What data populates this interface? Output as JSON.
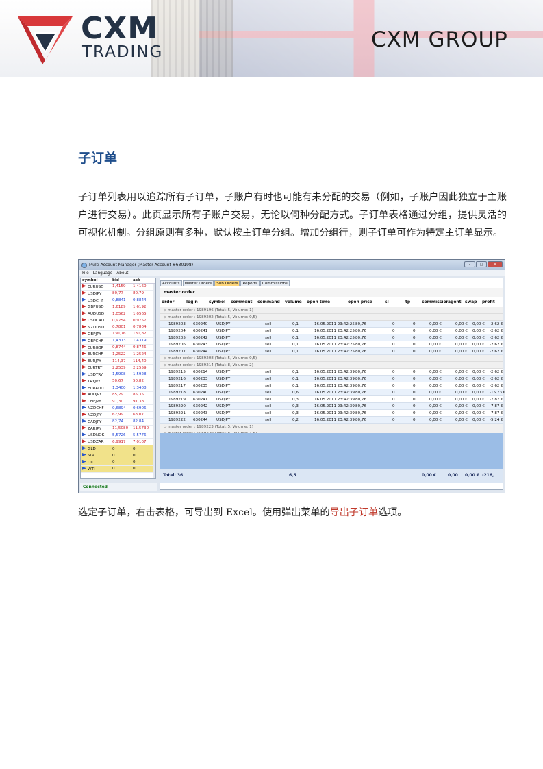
{
  "header": {
    "brand": "CXM",
    "brand_sub": "TRADING",
    "group": "CXM GROUP"
  },
  "section_title": "子订单",
  "paragraph1": "子订单列表用以追踪所有子订单，子账户有时也可能有未分配的交易（例如，子账户因此独立于主账户进行交易）。此页显示所有子账户交易，无论以何种分配方式。子订单表格通过分组，提供灵活的可视化机制。分组原则有多种，默认按主订单分组。增加分组行，则子订单可作为特定主订单显示。",
  "paragraph2": {
    "before": "选定子订单，右击表格，可导出到 Excel。使用弹出菜单的",
    "highlight": "导出子订单",
    "after": "选项。"
  },
  "window": {
    "title": "Multi Account Manager (Master Account #630198)",
    "menu": [
      "File",
      "Language",
      "About"
    ],
    "status": "Connected",
    "quotes_header": [
      "symbol",
      "bid",
      "ask"
    ],
    "quotes": [
      [
        "EURUSD",
        "1,4159",
        "1,4160",
        "dn"
      ],
      [
        "USDJPY",
        "80,77",
        "80,79",
        "dn"
      ],
      [
        "USDCHF",
        "0,8841",
        "0,8844",
        "up"
      ],
      [
        "GBPUSD",
        "1,6189",
        "1,6192",
        "dn"
      ],
      [
        "AUDUSD",
        "1,0562",
        "1,0565",
        "dn"
      ],
      [
        "USDCAD",
        "0,9754",
        "0,9757",
        "dn"
      ],
      [
        "NZDUSD",
        "0,7801",
        "0,7804",
        "dn"
      ],
      [
        "GBPJPY",
        "130,76",
        "130,82",
        "dn"
      ],
      [
        "GBPCHF",
        "1,4313",
        "1,4319",
        "up"
      ],
      [
        "EURGBP",
        "0,8744",
        "0,8746",
        "dn"
      ],
      [
        "EURCHF",
        "1,2522",
        "1,2524",
        "dn"
      ],
      [
        "EURJPY",
        "114,37",
        "114,40",
        "dn"
      ],
      [
        "EURTRY",
        "2,2539",
        "2,2559",
        "dn"
      ],
      [
        "USDTRY",
        "1,5908",
        "1,5928",
        "up"
      ],
      [
        "TRYJPY",
        "50,67",
        "50,82",
        "dn"
      ],
      [
        "EURAUD",
        "1,3400",
        "1,3408",
        "up"
      ],
      [
        "AUDJPY",
        "85,29",
        "85,35",
        "dn"
      ],
      [
        "CHFJPY",
        "91,30",
        "91,38",
        "dn"
      ],
      [
        "NZDCHF",
        "0,6894",
        "0,6906",
        "up"
      ],
      [
        "NZDJPY",
        "62,99",
        "63,07",
        "dn"
      ],
      [
        "CADJPY",
        "82,74",
        "82,84",
        "up"
      ],
      [
        "ZARJPY",
        "11,5080",
        "11,5730",
        "dn"
      ],
      [
        "USDNOK",
        "5,5726",
        "5,5776",
        "up"
      ],
      [
        "USDZAR",
        "6,9917",
        "7,0107",
        "dn"
      ],
      [
        "GLD",
        "0",
        "0",
        "gold"
      ],
      [
        "SLV",
        "0",
        "0",
        "gold"
      ],
      [
        "OIL",
        "0",
        "0",
        "gold"
      ],
      [
        "WTI",
        "0",
        "0",
        "gold"
      ]
    ],
    "tabs": [
      "Accounts",
      "Master Orders",
      "Sub Orders",
      "Reports",
      "Commissions"
    ],
    "group_by": "master order",
    "columns": [
      "order",
      "login",
      "symbol",
      "comment",
      "command",
      "volume",
      "open time",
      "open price",
      "sl",
      "tp",
      "commission",
      "agent",
      "swap",
      "profit"
    ],
    "rows": [
      {
        "group": "master order : 1989196 (Total: 5, Volume: 1)"
      },
      {
        "group": "master order : 1989202 (Total: 5, Volume: 0,5)"
      },
      {
        "d": [
          "1989203",
          "630240",
          "USDJPY",
          "",
          "sell",
          "0,1",
          "16.05.2011 23:42:25",
          "80,76",
          "0",
          "0",
          "0,00 €",
          "0,00 €",
          "0,00 €",
          "-2,62 €"
        ]
      },
      {
        "d": [
          "1989204",
          "630241",
          "USDJPY",
          "",
          "sell",
          "0,1",
          "16.05.2011 23:42:25",
          "80,76",
          "0",
          "0",
          "0,00 €",
          "0,00 €",
          "0,00 €",
          "-2,62 €"
        ]
      },
      {
        "d": [
          "1989205",
          "630242",
          "USDJPY",
          "",
          "sell",
          "0,1",
          "16.05.2011 23:42:25",
          "80,76",
          "0",
          "0",
          "0,00 €",
          "0,00 €",
          "0,00 €",
          "-2,62 €"
        ]
      },
      {
        "d": [
          "1989206",
          "630243",
          "USDJPY",
          "",
          "sell",
          "0,1",
          "16.05.2011 23:42:25",
          "80,76",
          "0",
          "0",
          "0,00 €",
          "0,00 €",
          "0,00 €",
          "-2,62 €"
        ]
      },
      {
        "d": [
          "1989207",
          "630244",
          "USDJPY",
          "",
          "sell",
          "0,1",
          "16.05.2011 23:42:25",
          "80,76",
          "0",
          "0",
          "0,00 €",
          "0,00 €",
          "0,00 €",
          "-2,62 €"
        ]
      },
      {
        "group": "master order : 1989208 (Total: 5, Volume: 0,5)"
      },
      {
        "group": "master order : 1989214 (Total: 8, Volume: 2)"
      },
      {
        "d": [
          "1989215",
          "630214",
          "USDJPY",
          "",
          "sell",
          "0,1",
          "16.05.2011 23:42:39",
          "80,76",
          "0",
          "0",
          "0,00 €",
          "0,00 €",
          "0,00 €",
          "-2,62 €"
        ]
      },
      {
        "d": [
          "1989216",
          "630233",
          "USDJPY",
          "",
          "sell",
          "0,1",
          "16.05.2011 23:42:39",
          "80,76",
          "0",
          "0",
          "0,00 €",
          "0,00 €",
          "0,00 €",
          "-2,62 €"
        ]
      },
      {
        "d": [
          "1989217",
          "630235",
          "USDJPY",
          "",
          "sell",
          "0,1",
          "16.05.2011 23:42:39",
          "80,76",
          "0",
          "0",
          "0,00 €",
          "0,00 €",
          "0,00 €",
          "-2,62 €"
        ]
      },
      {
        "d": [
          "1989218",
          "630240",
          "USDJPY",
          "",
          "sell",
          "0,6",
          "16.05.2011 23:42:39",
          "80,76",
          "0",
          "0",
          "0,00 €",
          "0,00 €",
          "0,00 €",
          "-15,73 €"
        ]
      },
      {
        "d": [
          "1989219",
          "630241",
          "USDJPY",
          "",
          "sell",
          "0,3",
          "16.05.2011 23:42:39",
          "80,76",
          "0",
          "0",
          "0,00 €",
          "0,00 €",
          "0,00 €",
          "-7,87 €"
        ]
      },
      {
        "d": [
          "1989220",
          "630242",
          "USDJPY",
          "",
          "sell",
          "0,3",
          "16.05.2011 23:42:39",
          "80,76",
          "0",
          "0",
          "0,00 €",
          "0,00 €",
          "0,00 €",
          "-7,87 €"
        ]
      },
      {
        "d": [
          "1989221",
          "630243",
          "USDJPY",
          "",
          "sell",
          "0,3",
          "16.05.2011 23:42:39",
          "80,76",
          "0",
          "0",
          "0,00 €",
          "0,00 €",
          "0,00 €",
          "-7,87 €"
        ]
      },
      {
        "d": [
          "1989222",
          "630244",
          "USDJPY",
          "",
          "sell",
          "0,2",
          "16.05.2011 23:42:39",
          "80,76",
          "0",
          "0",
          "0,00 €",
          "0,00 €",
          "0,00 €",
          "-5,24 €"
        ]
      },
      {
        "group": "master order : 1989223 (Total: 5, Volume: 1)"
      },
      {
        "group": "master order : 1989229 (Total: 8, Volume: 1,5)"
      }
    ],
    "total": {
      "label": "Total: 36",
      "volume": "6,5",
      "commission": "0,00 €",
      "agent": "0,00",
      "swap": "0,00 €",
      "profit": "-216,"
    }
  }
}
